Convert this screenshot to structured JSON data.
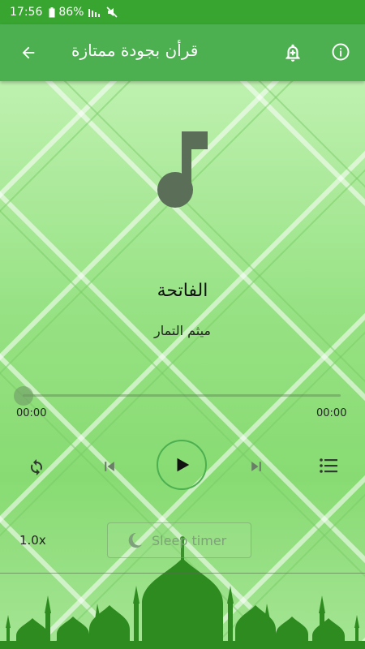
{
  "status_bar": {
    "time": "17:56",
    "battery": "86%"
  },
  "app_bar": {
    "title": "قرأن بجودة ممتازة"
  },
  "player": {
    "track_title": "الفاتحة",
    "reciter": "ميثم التمار",
    "current_time": "00:00",
    "total_time": "00:00",
    "progress": 0,
    "speed": "1.0x",
    "sleep_timer_label": "Sleep timer"
  },
  "colors": {
    "primary": "#4caf50",
    "status_bar": "#37a530",
    "mosque": "#2e8b1f"
  },
  "icons": [
    "back-arrow-icon",
    "bell-plus-icon",
    "info-icon",
    "music-note-icon",
    "repeat-icon",
    "skip-previous-icon",
    "play-icon",
    "skip-next-icon",
    "playlist-icon",
    "moon-icon"
  ]
}
